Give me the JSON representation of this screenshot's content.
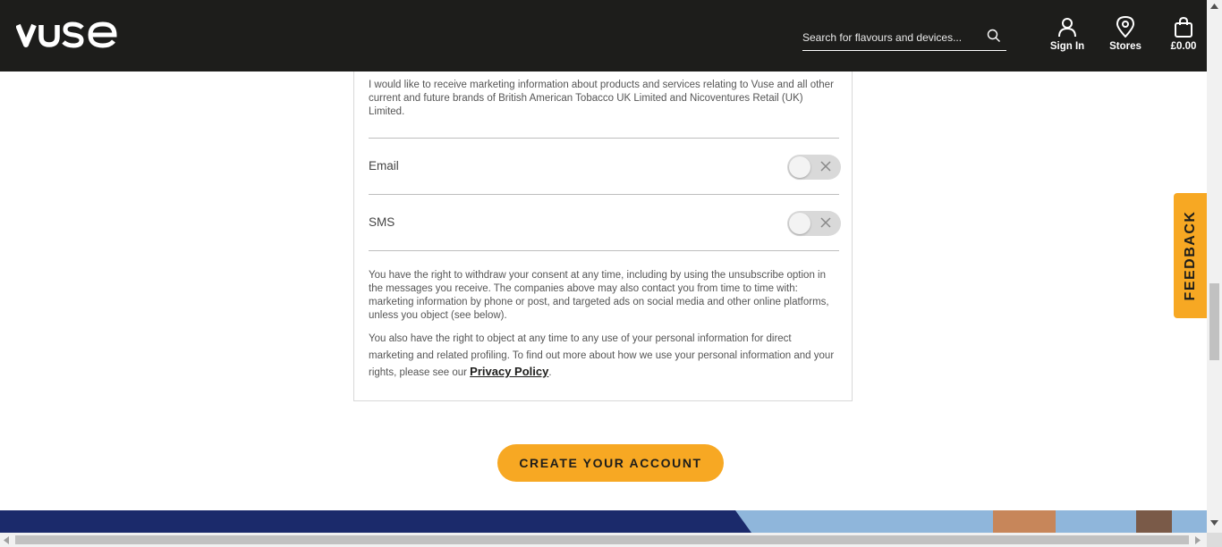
{
  "brand": {
    "logo_text": "vuse",
    "accent": "#f7a823",
    "header_bg": "#1d1d1b"
  },
  "search": {
    "placeholder": "Search for flavours and devices..."
  },
  "nav": {
    "sign_in": "Sign In",
    "stores": "Stores",
    "basket": "£0.00"
  },
  "marketing": {
    "intro": "I would like to receive marketing information about products and services relating to Vuse and all other current and future brands of British American Tobacco UK Limited and Nicoventures Retail (UK) Limited.",
    "options": [
      {
        "label": "Email",
        "enabled": false
      },
      {
        "label": "SMS",
        "enabled": false
      }
    ],
    "rights": "You have the right to withdraw your consent at any time, including by using the unsubscribe option in the messages you receive. The companies above may also contact you from time to time with: marketing information by phone or post, and targeted ads on social media and other online platforms, unless you object (see below).",
    "object_text": "You also have the right to object at any time to any use of your personal information for direct marketing and related profiling. To find out more about how we use your personal information and your rights, please see our ",
    "privacy_link": "Privacy Policy",
    "object_end": "."
  },
  "cta": {
    "label": "CREATE YOUR ACCOUNT"
  },
  "feedback": {
    "label": "FEEDBACK"
  }
}
